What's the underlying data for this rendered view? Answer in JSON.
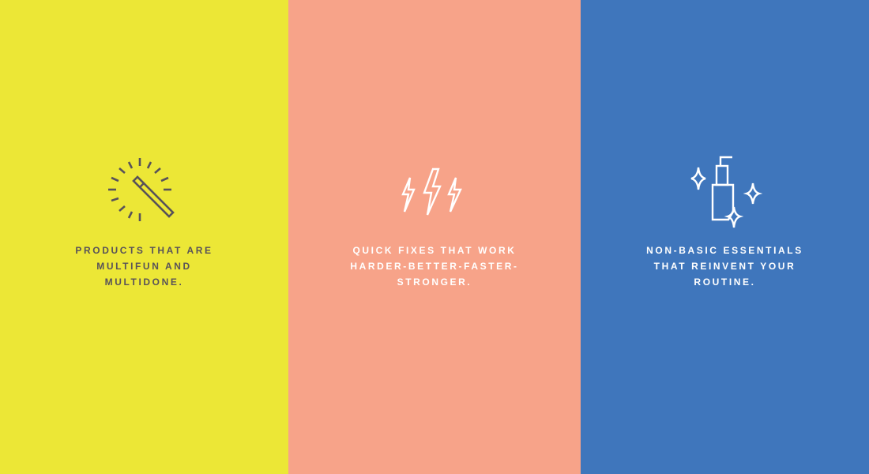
{
  "panels": [
    {
      "background": "#ece736",
      "text_color": "#585259",
      "icon": "magic-wand-icon",
      "lines": [
        "PRODUCTS THAT ARE",
        "MULTIFUN AND",
        "MULTIDONE."
      ]
    },
    {
      "background": "#f7a389",
      "text_color": "#ffffff",
      "icon": "lightning-bolts-icon",
      "lines": [
        "QUICK FIXES THAT WORK",
        "HARDER-BETTER-FASTER-",
        "STRONGER."
      ]
    },
    {
      "background": "#3f76bc",
      "text_color": "#ffffff",
      "icon": "sparkling-pump-bottle-icon",
      "lines": [
        "NON-BASIC ESSENTIALS",
        "THAT REINVENT YOUR",
        "ROUTINE."
      ]
    }
  ]
}
